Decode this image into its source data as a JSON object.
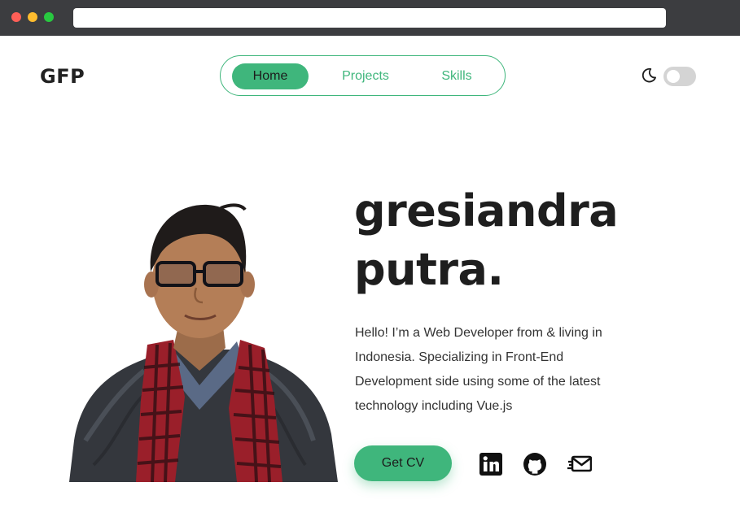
{
  "browser": {
    "traffic_lights": [
      "close",
      "minimize",
      "maximize"
    ],
    "address_bar_value": ""
  },
  "header": {
    "logo": "GFP",
    "nav": [
      {
        "label": "Home",
        "active": true
      },
      {
        "label": "Projects",
        "active": false
      },
      {
        "label": "Skills",
        "active": false
      }
    ],
    "theme_toggle": {
      "icon": "moon-icon",
      "on": false
    }
  },
  "hero": {
    "name_line1": "gresiandra",
    "name_line2": "putra.",
    "bio": "Hello! I’m a Web Developer from & living in Indonesia. Specializing in Front-End Development side using some of the latest technology including Vue.js",
    "cv_button": "Get CV",
    "photo": "portrait-photo",
    "social": [
      "linkedin-icon",
      "github-icon",
      "mail-icon"
    ]
  },
  "colors": {
    "accent": "#3fb67c",
    "text": "#1e1e1e",
    "toggle_track": "#d4d4d4",
    "chrome": "#3c3d40"
  }
}
